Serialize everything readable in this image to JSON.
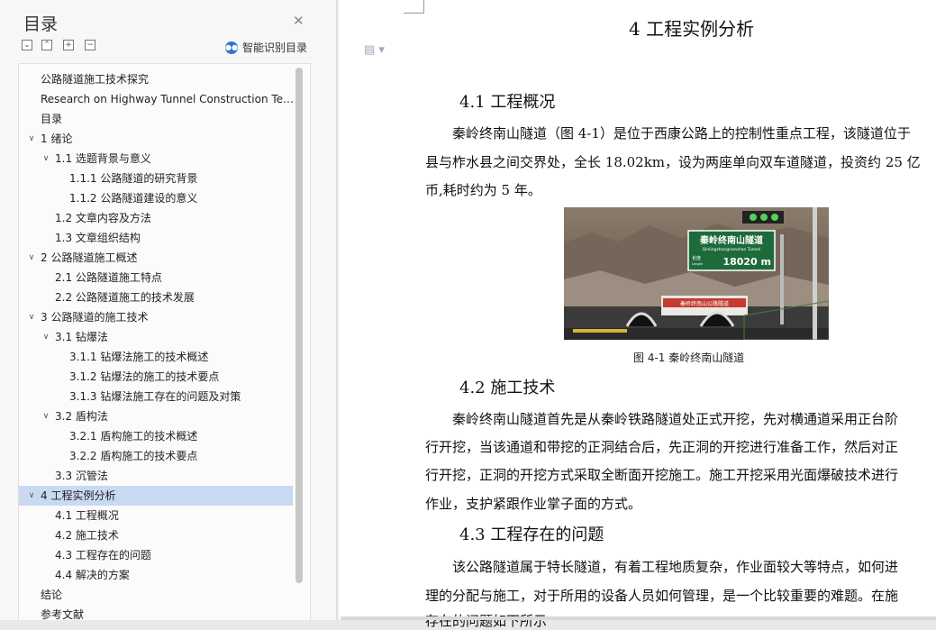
{
  "sidebar": {
    "title": "目录",
    "smart_label": "智能识别目录",
    "items": [
      {
        "label": "公路隧道施工技术探究",
        "level": 0,
        "caret": ""
      },
      {
        "label": "Research on Highway Tunnel Construction Te…",
        "level": 0,
        "caret": ""
      },
      {
        "label": "目录",
        "level": 0,
        "caret": ""
      },
      {
        "label": "1 绪论",
        "level": 0,
        "caret": "open"
      },
      {
        "label": "1.1 选题背景与意义",
        "level": 1,
        "caret": "open"
      },
      {
        "label": "1.1.1 公路隧道的研究背景",
        "level": 2,
        "caret": ""
      },
      {
        "label": "1.1.2 公路隧道建设的意义",
        "level": 2,
        "caret": ""
      },
      {
        "label": "1.2 文章内容及方法",
        "level": 1,
        "caret": ""
      },
      {
        "label": "1.3 文章组织结构",
        "level": 1,
        "caret": ""
      },
      {
        "label": "2 公路隧道施工概述",
        "level": 0,
        "caret": "open"
      },
      {
        "label": "2.1 公路隧道施工特点",
        "level": 1,
        "caret": ""
      },
      {
        "label": "2.2 公路隧道施工的技术发展",
        "level": 1,
        "caret": ""
      },
      {
        "label": "3 公路隧道的施工技术",
        "level": 0,
        "caret": "open"
      },
      {
        "label": "3.1 钻爆法",
        "level": 1,
        "caret": "open"
      },
      {
        "label": "3.1.1 钻爆法施工的技术概述",
        "level": 2,
        "caret": ""
      },
      {
        "label": "3.1.2 钻爆法的施工的技术要点",
        "level": 2,
        "caret": ""
      },
      {
        "label": "3.1.3 钻爆法施工存在的问题及对策",
        "level": 2,
        "caret": ""
      },
      {
        "label": "3.2 盾构法",
        "level": 1,
        "caret": "open"
      },
      {
        "label": "3.2.1 盾构施工的技术概述",
        "level": 2,
        "caret": ""
      },
      {
        "label": "3.2.2 盾构施工的技术要点",
        "level": 2,
        "caret": ""
      },
      {
        "label": "3.3 沉管法",
        "level": 1,
        "caret": ""
      },
      {
        "label": "4 工程实例分析",
        "level": 0,
        "caret": "open",
        "selected": true
      },
      {
        "label": "4.1 工程概况",
        "level": 1,
        "caret": ""
      },
      {
        "label": "4.2 施工技术",
        "level": 1,
        "caret": ""
      },
      {
        "label": "4.3 工程存在的问题",
        "level": 1,
        "caret": ""
      },
      {
        "label": "4.4 解决的方案",
        "level": 1,
        "caret": ""
      },
      {
        "label": "结论",
        "level": 0,
        "caret": ""
      },
      {
        "label": "参考文献",
        "level": 0,
        "caret": ""
      }
    ]
  },
  "document": {
    "chapter_title": "4  工程实例分析",
    "s1_heading": "4.1  工程概况",
    "s1_lines": [
      "秦岭终南山隧道（图 4-1）是位于西康公路上的控制性重点工程，该隧道位于",
      "县与柞水县之间交界处，全长 18.02km，设为两座单向双车道隧道，投资约 25 亿",
      "币,耗时约为 5 年。"
    ],
    "sign_title": "秦岭终南山隧道",
    "sign_pinyin": "Qinlingzhongnanshan Tunnel",
    "sign_length_label": "长度",
    "sign_length_sub": "Length",
    "sign_length": "18020 m",
    "portal_banner": "秦岭终南山公路隧道",
    "figure_caption": "图 4-1  秦岭终南山隧道",
    "s2_heading": "4.2  施工技术",
    "s2_lines": [
      "秦岭终南山隧道首先是从秦岭铁路隧道处正式开挖，先对横通道采用正台阶",
      "行开挖，当该通道和带挖的正洞结合后，先正洞的开挖进行准备工作，然后对正",
      "行开挖，正洞的开挖方式采取全断面开挖施工。施工开挖采用光面爆破技术进行",
      "作业，支护紧跟作业掌子面的方式。"
    ],
    "s3_heading": "4.3  工程存在的问题",
    "s3_lines": [
      "该公路隧道属于特长隧道，有着工程地质复杂，作业面较大等特点，如何进",
      "理的分配与施工，对于所用的设备人员如何管理，是一个比较重要的难题。在施",
      "存在的问题如下所示"
    ]
  },
  "colors": {
    "selected_row": "#c9d9f2",
    "sign_green": "#1d6b3a",
    "smart_icon": "#2e74d6"
  },
  "icons": [
    "close-icon",
    "collapse-all-icon",
    "expand-all-icon",
    "add-heading-icon",
    "remove-heading-icon",
    "smart-toc-icon",
    "doc-view-icon",
    "chevron-down-icon"
  ]
}
